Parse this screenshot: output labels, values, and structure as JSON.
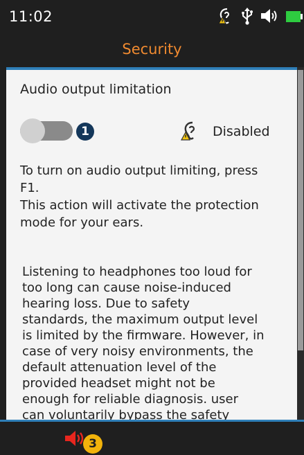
{
  "status_bar": {
    "time": "11:02",
    "icons": [
      "hearing-protection-icon",
      "usb-icon",
      "speaker-icon",
      "battery-icon"
    ],
    "battery_color": "#2ecc40"
  },
  "header": {
    "title": "Security",
    "title_color": "#f08a30"
  },
  "audio_limit": {
    "section_title": "Audio output limitation",
    "toggle_on": false,
    "badge_number": "1",
    "status_label": "Disabled"
  },
  "instructions": {
    "lines": [
      "To turn on audio output limiting, press",
      "F1.",
      "This action will activate the protection",
      "mode for your ears."
    ]
  },
  "warning": {
    "lines": [
      "Listening to headphones too loud for",
      "too long can cause noise-induced",
      "hearing loss. Due to safety",
      "standards, the maximum output level",
      "is limited by the firmware. However, in",
      "case of very noisy environments, the",
      "default attenuation level of the",
      "provided headset might not be",
      "enough for reliable diagnosis. user",
      "can voluntarily bypass the safety"
    ]
  },
  "bottom_bar": {
    "f1_icon": "speaker-red-icon",
    "f1_color": "#e8261e",
    "badge_number": "3",
    "badge_color": "#f2b30b"
  },
  "accent_color": "#2f7fb8"
}
